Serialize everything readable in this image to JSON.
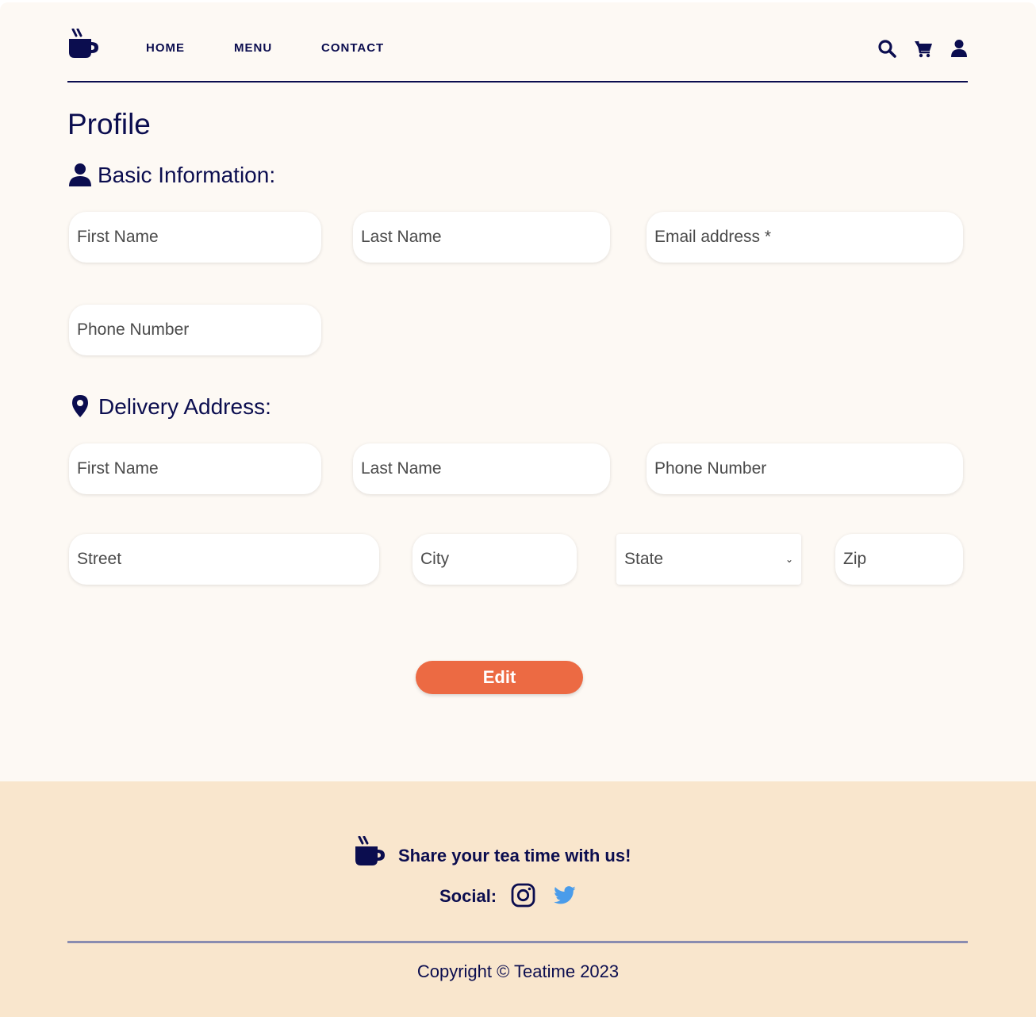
{
  "nav": {
    "logo_icon": "teacup-icon",
    "links": [
      "HOME",
      "MENU",
      "CONTACT"
    ],
    "icons": [
      "search-icon",
      "cart-icon",
      "user-icon"
    ]
  },
  "page": {
    "title": "Profile"
  },
  "basic_info": {
    "title": "Basic Information:",
    "icon": "user-icon",
    "first_name_placeholder": "First Name",
    "last_name_placeholder": "Last Name",
    "email_placeholder": "Email address *",
    "phone_placeholder": "Phone Number"
  },
  "delivery": {
    "title": "Delivery Address:",
    "icon": "location-pin-icon",
    "first_name_placeholder": "First Name",
    "last_name_placeholder": "Last Name",
    "phone_placeholder": "Phone Number",
    "street_placeholder": "Street",
    "city_placeholder": "City",
    "state_selected": "State",
    "zip_placeholder": "Zip"
  },
  "actions": {
    "edit_label": "Edit"
  },
  "footer": {
    "tagline": "Share your tea time with us!",
    "social_label": "Social:",
    "social_icons": [
      "instagram-icon",
      "twitter-icon"
    ],
    "copyright": "Copyright © Teatime 2023"
  },
  "colors": {
    "primary": "#0b0d4f",
    "accent": "#ec6a43",
    "page_bg": "#fdf9f4",
    "footer_bg": "#f9e6cd",
    "twitter": "#4a9cea"
  }
}
